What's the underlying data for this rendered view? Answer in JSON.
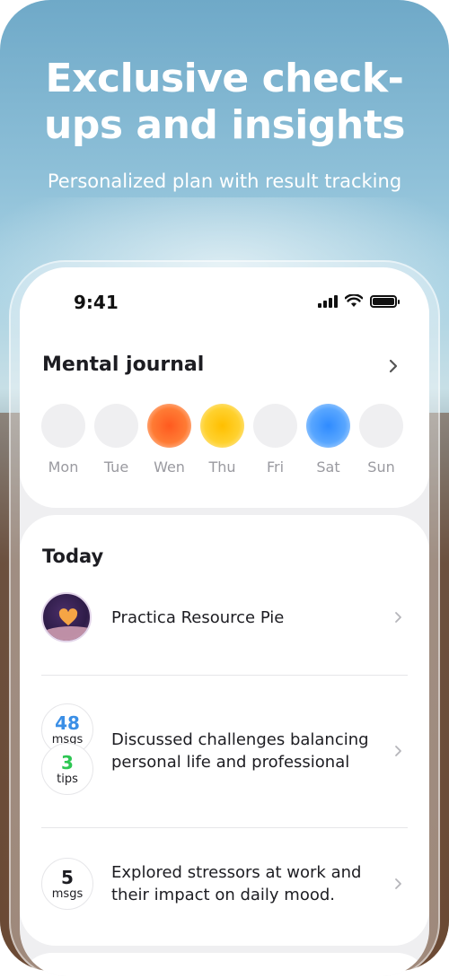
{
  "promo": {
    "headline_line1": "Exclusive check-",
    "headline_line2": "ups and insights",
    "subhead": "Personalized plan with result tracking"
  },
  "status_bar": {
    "time": "9:41"
  },
  "journal": {
    "title": "Mental journal",
    "days": [
      {
        "label": "Mon",
        "mood_color": "none"
      },
      {
        "label": "Tue",
        "mood_color": "none"
      },
      {
        "label": "Wen",
        "mood_color": "#FF5A1F"
      },
      {
        "label": "Thu",
        "mood_color": "#FFBF00"
      },
      {
        "label": "Fri",
        "mood_color": "none"
      },
      {
        "label": "Sat",
        "mood_color": "#2F8BFF"
      },
      {
        "label": "Sun",
        "mood_color": "none"
      }
    ]
  },
  "today": {
    "title": "Today",
    "items": [
      {
        "text": "Practica Resource Pie",
        "icon": "heart-avatar-icon"
      },
      {
        "text_line1": "Discussed challenges balancing",
        "text_line2": "personal life and professional",
        "badges": [
          {
            "value": "48",
            "unit": "msgs",
            "color": "#3B8FE6"
          },
          {
            "value": "3",
            "unit": "tips",
            "color": "#2DC653"
          }
        ]
      },
      {
        "text_line1": "Explored stressors at work and",
        "text_line2": "their impact on daily mood.",
        "badges": [
          {
            "value": "5",
            "unit": "msgs",
            "color": "#1D1D22"
          }
        ]
      }
    ]
  },
  "colors": {
    "accent_blue": "#3B8FE6",
    "accent_green": "#2DC653",
    "text_dark": "#1D1D22",
    "muted": "#9A9AA0"
  }
}
